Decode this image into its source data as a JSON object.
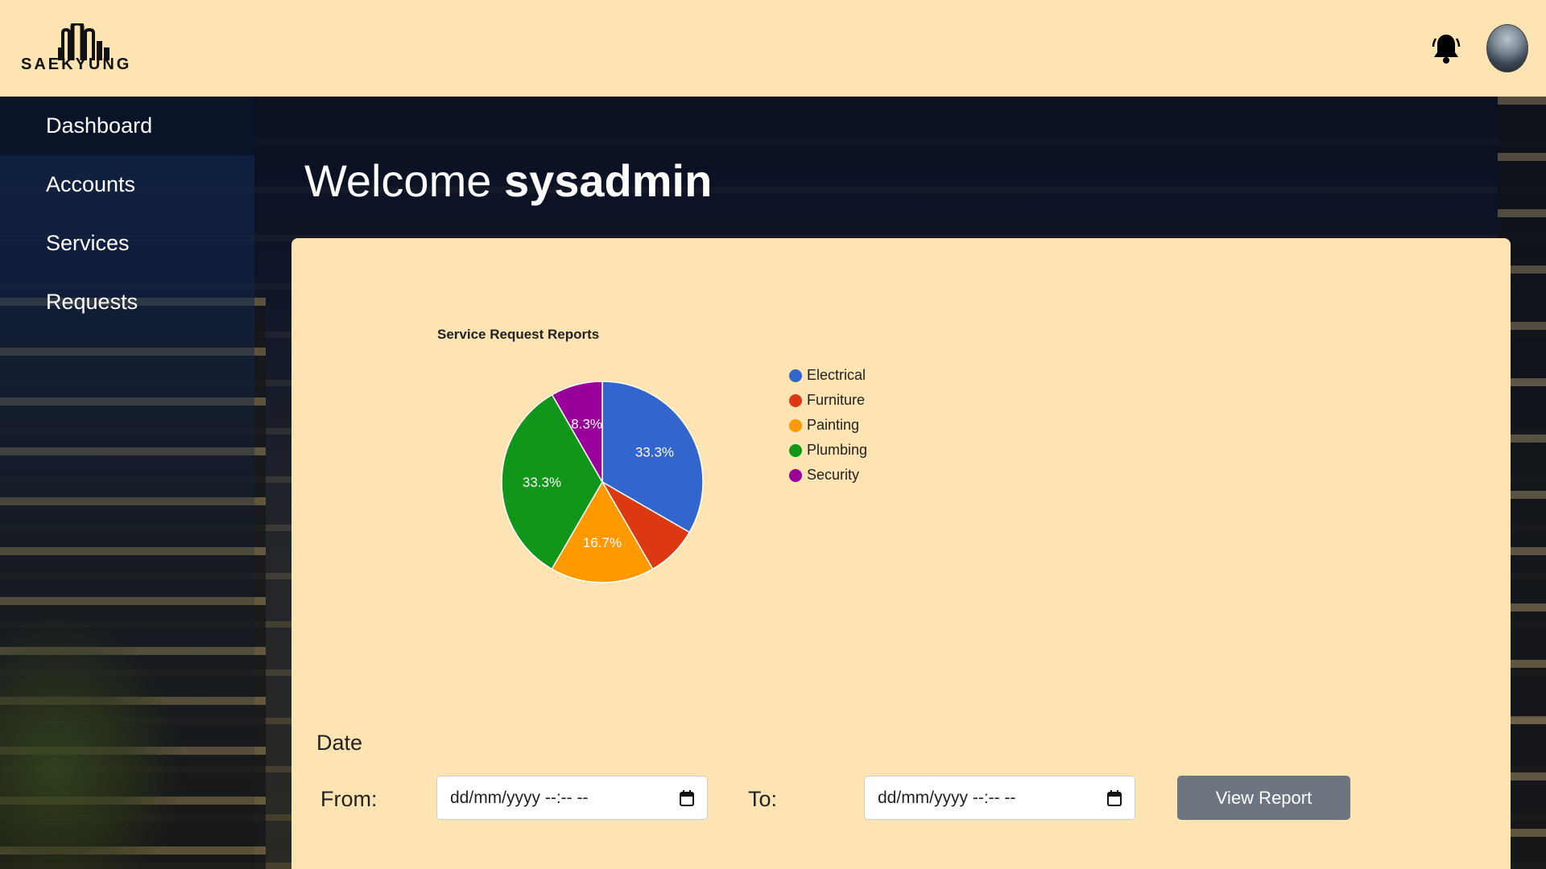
{
  "header": {
    "logo_text": "SAEKYUNG",
    "bell_icon": "bell-icon",
    "avatar": "user-avatar"
  },
  "sidebar": {
    "items": [
      {
        "label": "Dashboard",
        "active": true
      },
      {
        "label": "Accounts",
        "active": false
      },
      {
        "label": "Services",
        "active": false
      },
      {
        "label": "Requests",
        "active": false
      }
    ]
  },
  "welcome": {
    "greeting": "Welcome",
    "username": "sysadmin"
  },
  "chart_data": {
    "type": "pie",
    "title": "Service Request Reports",
    "categories": [
      "Electrical",
      "Furniture",
      "Painting",
      "Plumbing",
      "Security"
    ],
    "values": [
      33.3,
      8.3,
      16.7,
      33.3,
      8.3
    ],
    "labels": [
      "33.3%",
      "",
      "16.7%",
      "33.3%",
      "8.3%"
    ],
    "colors": [
      "#3366cc",
      "#dc3912",
      "#ff9900",
      "#109618",
      "#990099"
    ],
    "legend_position": "right"
  },
  "report": {
    "date_label": "Date",
    "from_label": "From:",
    "to_label": "To:",
    "from_placeholder": "dd/mm/yyyy --:-- --",
    "to_placeholder": "dd/mm/yyyy --:-- --",
    "calendar_icon": "calendar-icon",
    "button_label": "View Report"
  }
}
